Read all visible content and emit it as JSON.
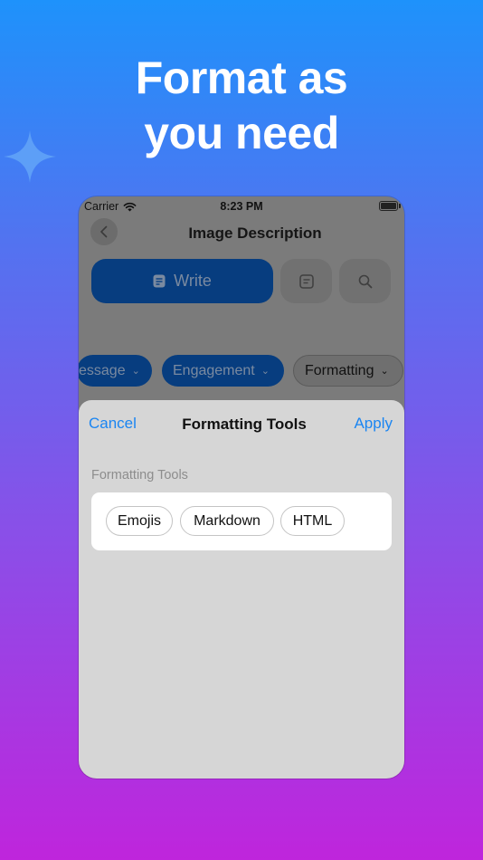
{
  "headline": {
    "line1": "Format as",
    "line2": "you need"
  },
  "status_bar": {
    "carrier": "Carrier",
    "time": "8:23 PM"
  },
  "nav": {
    "title": "Image Description"
  },
  "toolbar": {
    "write_label": "Write"
  },
  "categories": [
    {
      "label": "essage"
    },
    {
      "label": "Engagement"
    },
    {
      "label": "Formatting"
    }
  ],
  "sheet": {
    "cancel_label": "Cancel",
    "title": "Formatting Tools",
    "apply_label": "Apply",
    "section_label": "Formatting Tools",
    "options": [
      {
        "label": "Emojis"
      },
      {
        "label": "Markdown"
      },
      {
        "label": "HTML"
      }
    ]
  },
  "colors": {
    "gradient_top": "#1e92fb",
    "gradient_bottom": "#bf25dc",
    "accent": "#1a85f2",
    "primary_button": "#073d7f",
    "sheet_background": "#d6d6d6"
  }
}
